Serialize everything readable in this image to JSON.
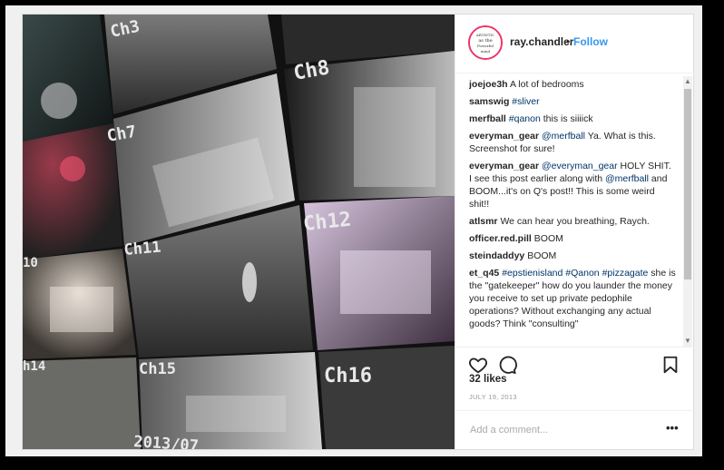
{
  "post": {
    "username": "ray.chandler",
    "separator": "•",
    "follow_label": "Follow",
    "avatar_text": [
      "ARTISTIC",
      "as the",
      "Powerful",
      "mind"
    ],
    "image_labels": [
      "Ch3",
      "Ch8",
      "Ch7",
      "Ch12",
      "Ch11",
      "10",
      "h14",
      "Ch15",
      "Ch16",
      "2013/07"
    ],
    "comments": [
      {
        "user": "joejoe3h",
        "parts": [
          {
            "t": "A lot of bedrooms"
          }
        ]
      },
      {
        "user": "samswig",
        "parts": [
          {
            "t": "#sliver",
            "tag": true
          }
        ]
      },
      {
        "user": "merfball",
        "parts": [
          {
            "t": "#qanon",
            "tag": true
          },
          {
            "t": " this is siiiick"
          }
        ]
      },
      {
        "user": "everyman_gear",
        "parts": [
          {
            "t": "@merfball",
            "tag": true
          },
          {
            "t": " Ya. What is this. Screenshot for sure!"
          }
        ]
      },
      {
        "user": "everyman_gear",
        "parts": [
          {
            "t": "@everyman_gear",
            "tag": true
          },
          {
            "t": " HOLY SHIT. I see this post earlier along with "
          },
          {
            "t": "@merfball",
            "tag": true
          },
          {
            "t": " and BOOM...it's on Q's post!! This is some weird shit!!"
          }
        ]
      },
      {
        "user": "atlsmr",
        "parts": [
          {
            "t": "We can hear you breathing, Raych."
          }
        ]
      },
      {
        "user": "officer.red.pill",
        "parts": [
          {
            "t": "BOOM"
          }
        ]
      },
      {
        "user": "steindaddyy",
        "parts": [
          {
            "t": "BOOM"
          }
        ]
      },
      {
        "user": "et_q45",
        "parts": [
          {
            "t": "#epstienisland",
            "tag": true
          },
          {
            "t": " "
          },
          {
            "t": "#Qanon",
            "tag": true
          },
          {
            "t": " "
          },
          {
            "t": "#pizzagate",
            "tag": true
          },
          {
            "t": " she is the \"gatekeeper\" how do you launder the money you receive to set up private pedophile operations? Without exchanging any actual goods? Think \"consulting\""
          }
        ]
      }
    ],
    "likes": "32 likes",
    "date": "JULY 19, 2013",
    "add_comment_placeholder": "Add a comment...",
    "more_label": "•••",
    "icons": {
      "like": "heart-icon",
      "comment": "comment-icon",
      "save": "bookmark-icon",
      "scroll_up": "chevron-up-icon",
      "scroll_down": "chevron-down-icon"
    },
    "colors": {
      "link": "#3897f0",
      "hashtag": "#003569",
      "text": "#262626",
      "muted": "#999999"
    }
  }
}
